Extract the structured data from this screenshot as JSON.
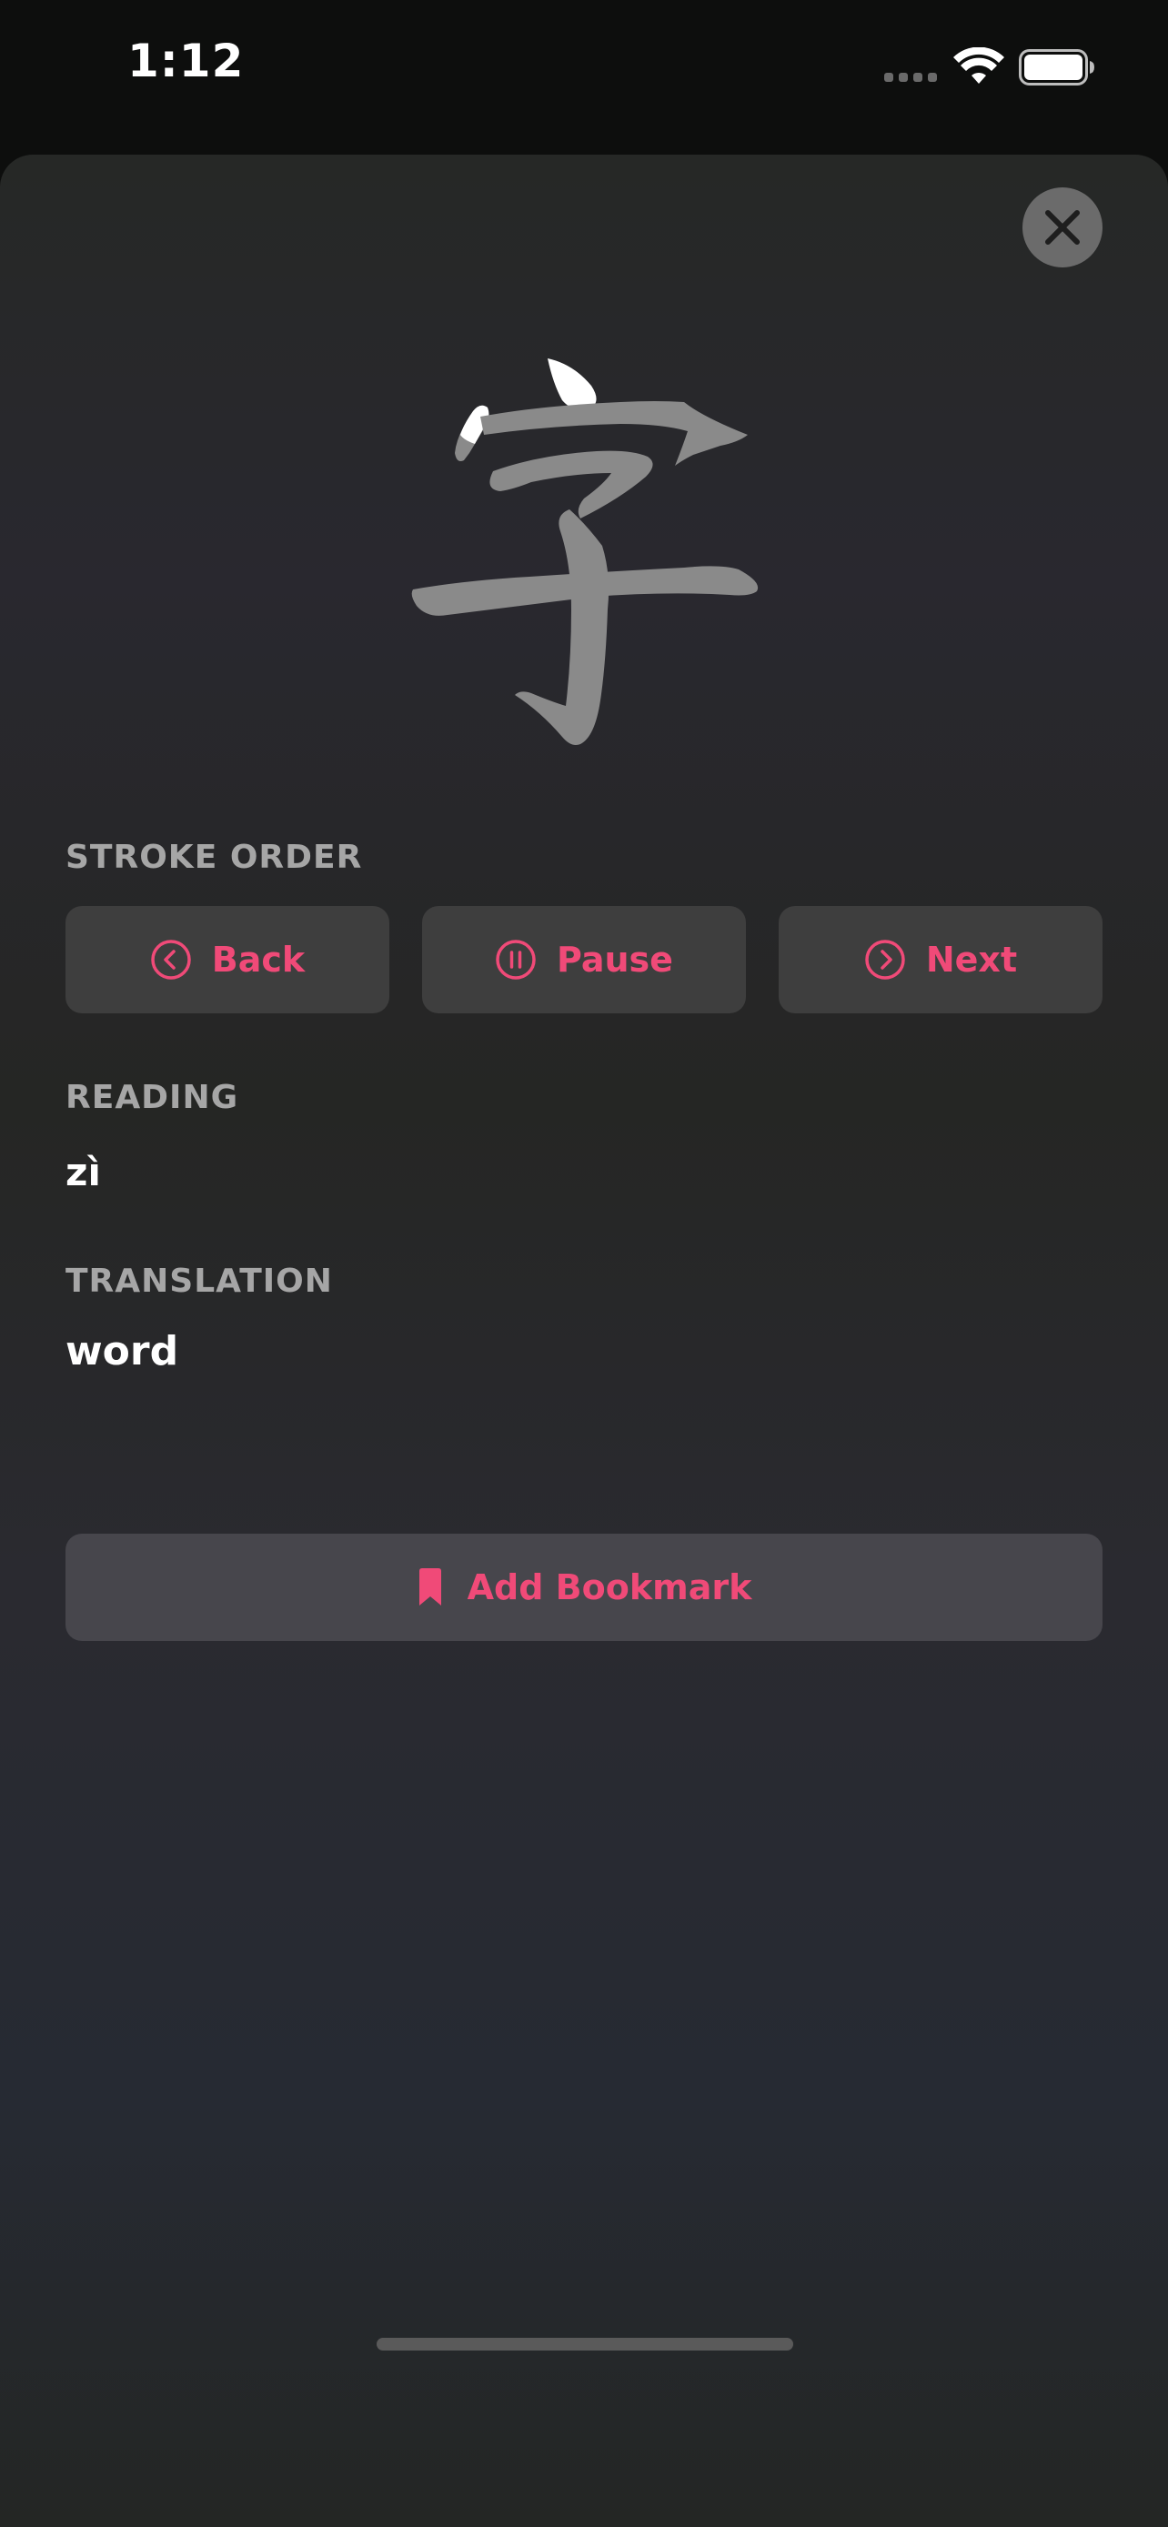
{
  "status_bar": {
    "time": "1:12"
  },
  "character": {
    "glyph": "字"
  },
  "stroke_order": {
    "label": "STROKE ORDER",
    "buttons": [
      {
        "label": "Back",
        "icon": "chevron-left-circle-icon"
      },
      {
        "label": "Pause",
        "icon": "pause-circle-icon"
      },
      {
        "label": "Next",
        "icon": "chevron-right-circle-icon"
      }
    ]
  },
  "reading": {
    "label": "READING",
    "value": "zì"
  },
  "translation": {
    "label": "TRANSLATION",
    "value": "word"
  },
  "bookmark": {
    "label": "Add Bookmark",
    "icon": "bookmark-icon"
  },
  "colors": {
    "accent": "#f04a78",
    "button_bg": "#3e3e3e",
    "bookmark_bg": "#47464c",
    "stroke_done": "#ffffff",
    "stroke_pending": "#8a8a8a"
  }
}
